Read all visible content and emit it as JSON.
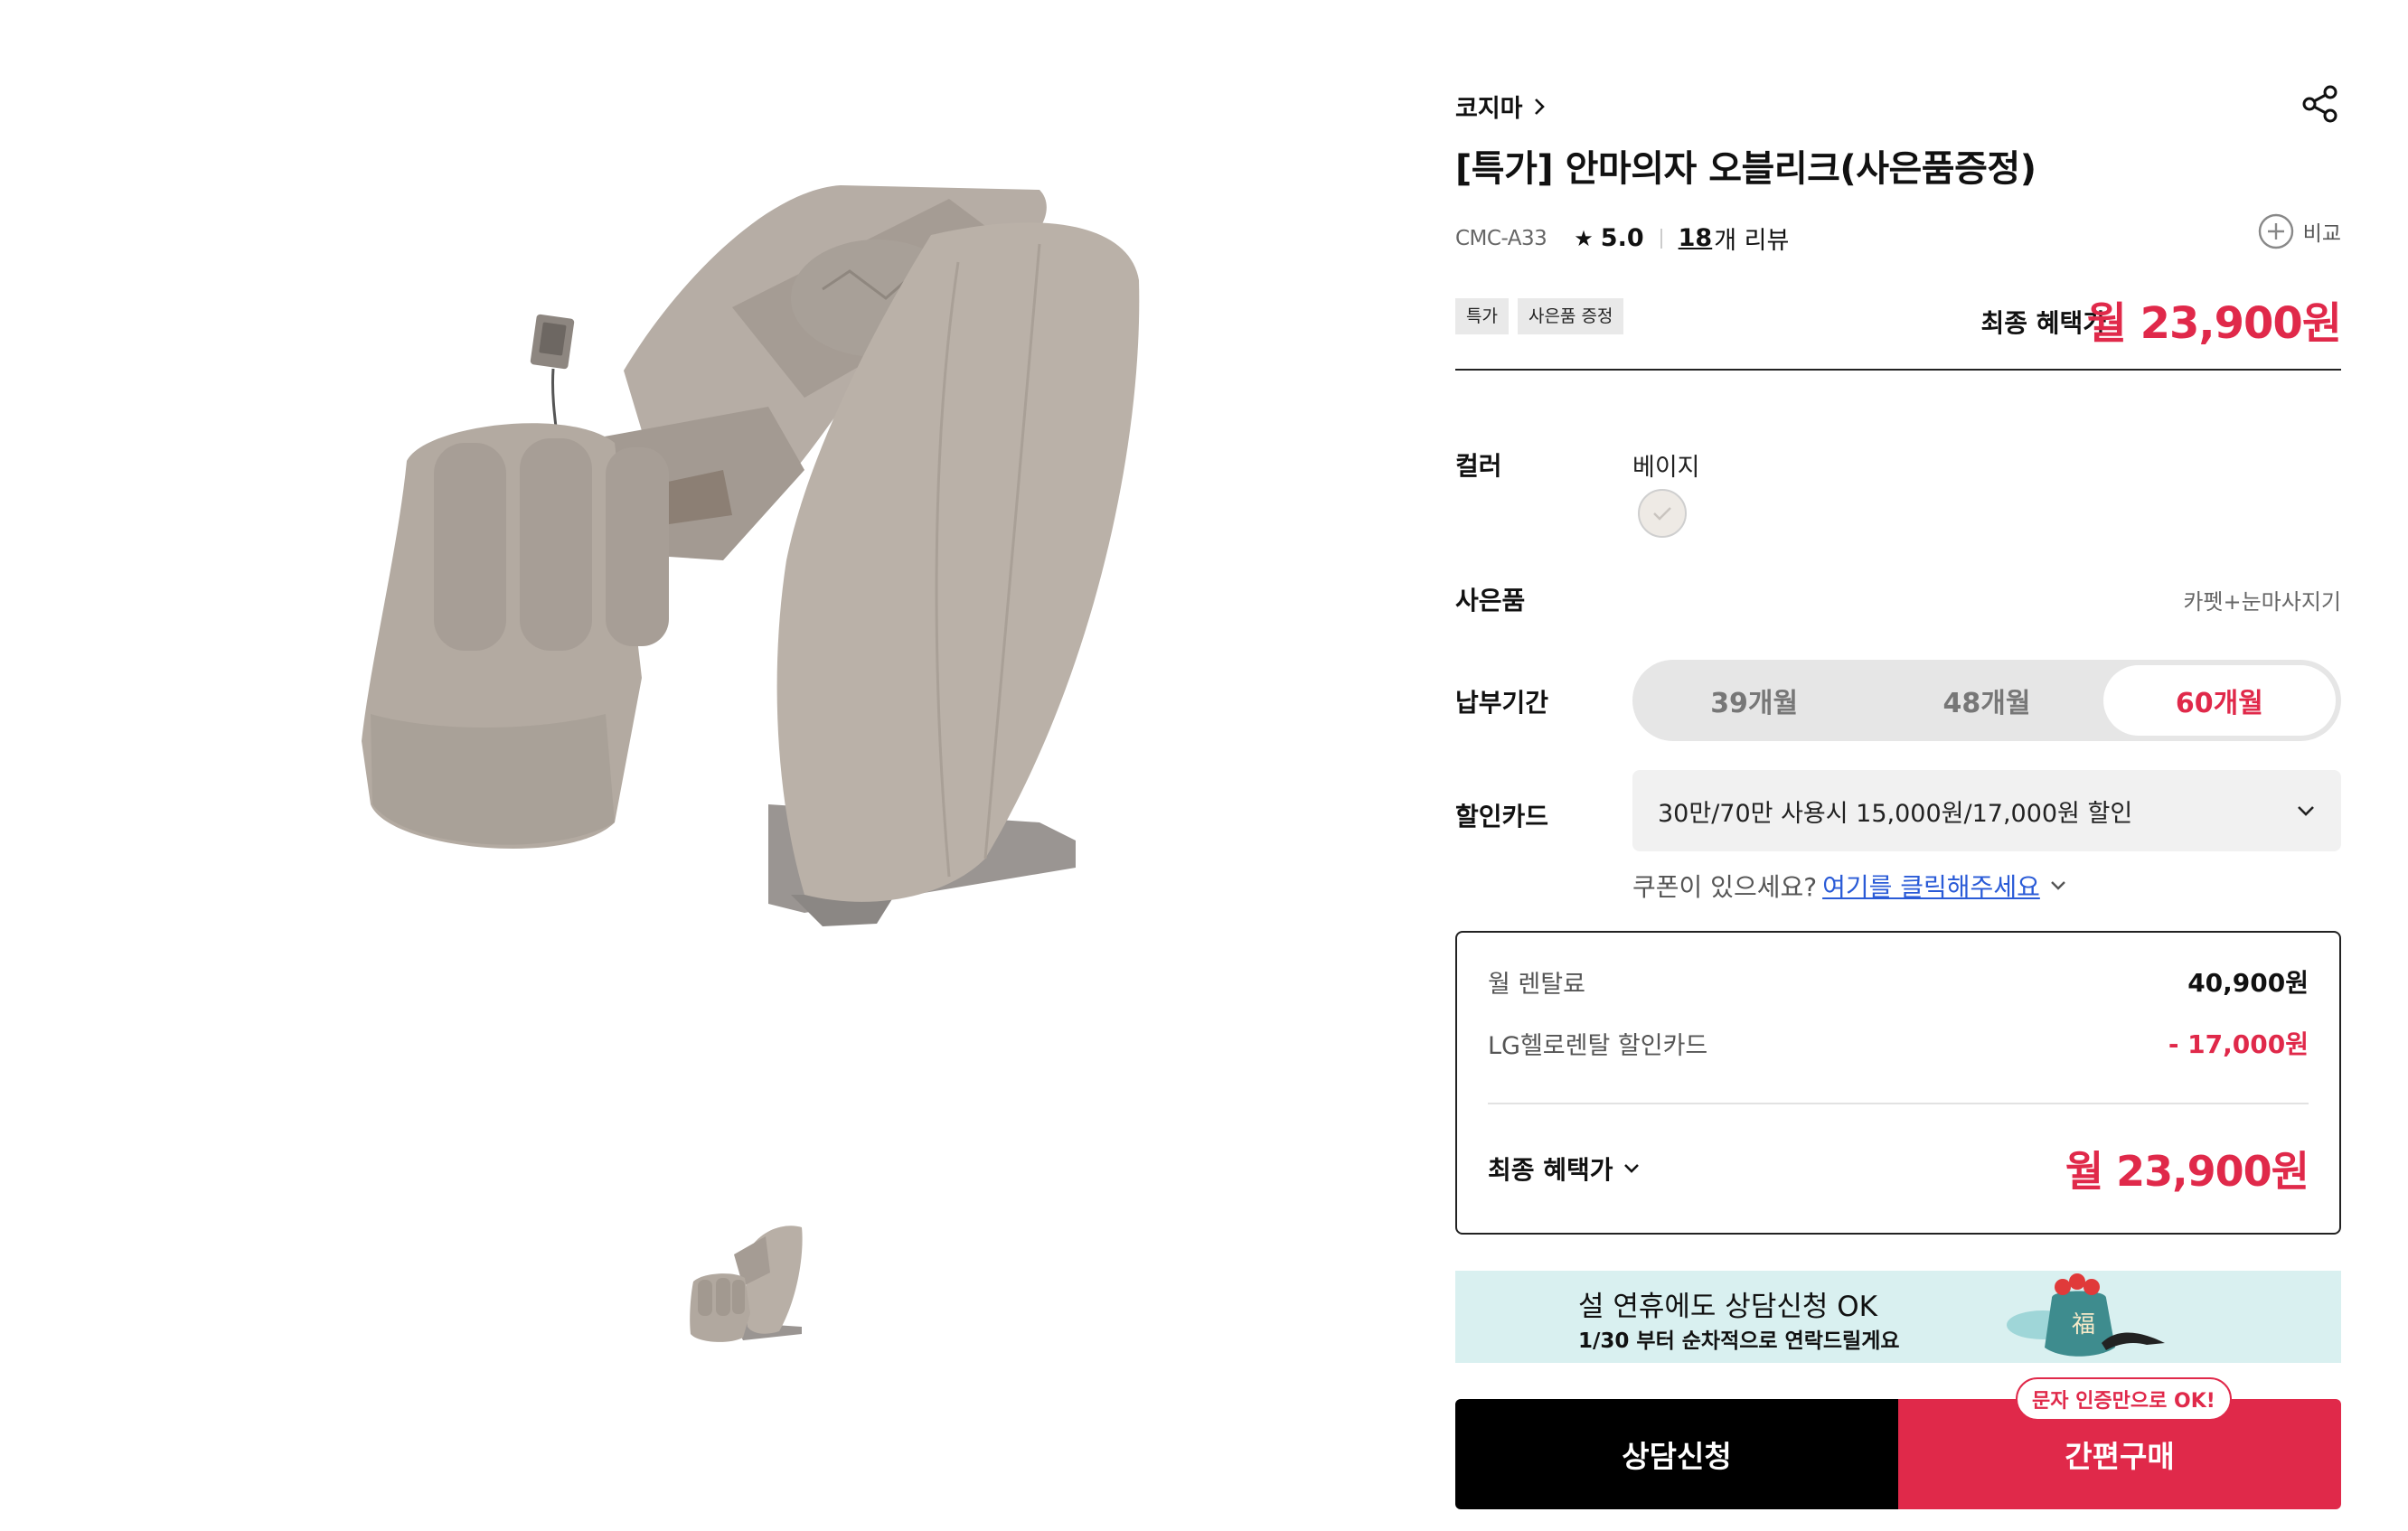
{
  "product": {
    "brand": "코지마",
    "title": "[특가] 안마의자 오블리크(사은품증정)",
    "model": "CMC-A33",
    "rating": "5.0",
    "review_count": "18",
    "review_unit": "개 리뷰",
    "compare_label": "비교",
    "badges": [
      "특가",
      "사은품 증정"
    ],
    "final_price_label": "최종 혜택가",
    "final_price": "월 23,900원"
  },
  "options": {
    "color_label": "컬러",
    "color_name": "베이지",
    "gift_label": "사은품",
    "gift_value": "카펫+눈마사지기",
    "period_label": "납부기간",
    "periods": [
      "39개월",
      "48개월",
      "60개월"
    ],
    "period_selected": "60개월",
    "card_label": "할인카드",
    "card_value": "30만/70만 사용시 15,000원/17,000원 할인",
    "coupon_question": "쿠폰이 있으세요?",
    "coupon_link": "여기를 클릭해주세요"
  },
  "price_box": {
    "monthly_label": "월 렌탈료",
    "monthly_value": "40,900원",
    "card_discount_label": "LG헬로렌탈 할인카드",
    "card_discount_value": "- 17,000원",
    "final_label": "최종 혜택가",
    "final_value": "월 23,900원"
  },
  "banner": {
    "line1": "설 연휴에도 상담신청 OK",
    "line2": "1/30 부터 순차적으로 연락드릴게요",
    "art_glyph": "福"
  },
  "actions": {
    "consult": "상담신청",
    "buy": "간편구매",
    "tooltip": "문자 인증만으로 OK!"
  },
  "colors": {
    "accent": "#e0294a",
    "link": "#2a5bd7",
    "chair_beige": "#b3aba2",
    "banner_bg": "#d9f0f0"
  },
  "icons": [
    "chevron-right-icon",
    "share-icon",
    "star-icon",
    "plus-circle-icon",
    "check-icon",
    "chevron-down-icon"
  ]
}
